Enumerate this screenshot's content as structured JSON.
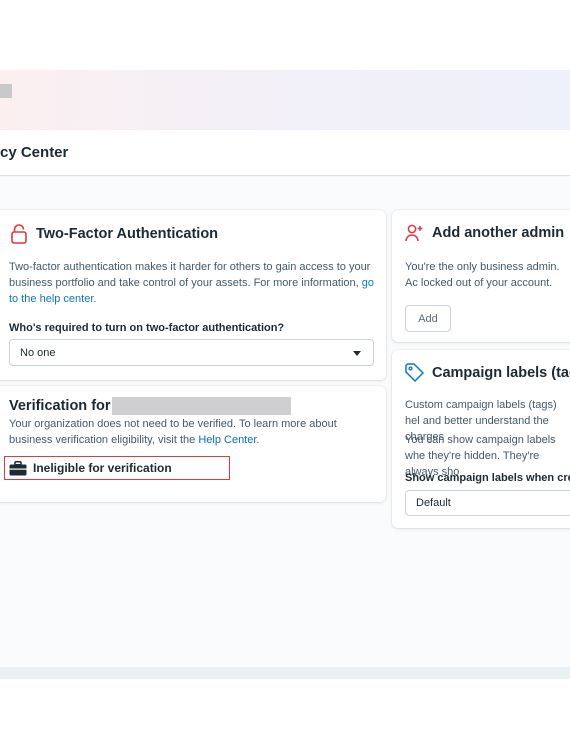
{
  "page": {
    "title": "cy Center"
  },
  "colors": {
    "accent_link": "#0a78be",
    "danger_outline": "#e0393e",
    "lock_icon": "#e0393e",
    "admin_icon": "#e0393e",
    "tag_icon": "#0a78be"
  },
  "two_factor": {
    "title": "Two-Factor Authentication",
    "icon": "lock-icon",
    "description": "Two-factor authentication makes it harder for others to gain access to your business portfolio and take control of your assets. For more information, ",
    "link_text": "go to the help center",
    "link_suffix": ".",
    "required_label": "Who's required to turn on two-factor authentication?",
    "required_value": "No one"
  },
  "verification": {
    "title": "Verification for",
    "description": "Your organization does not need to be verified. To learn more about business verification eligibility, visit the ",
    "link_text": "Help Center",
    "link_suffix": ".",
    "status_icon": "briefcase-icon",
    "status_label": "Ineligible for verification"
  },
  "add_admin": {
    "title": "Add another admin",
    "icon": "person-add-icon",
    "description": "You're the only business admin. Ac locked out of your account.",
    "button_label": "Add"
  },
  "campaign_labels": {
    "title": "Campaign labels (tags",
    "icon": "tag-icon",
    "description_1": "Custom campaign labels (tags) hel and better understand the charges",
    "description_2": "You can show campaign labels whe they're hidden. They're always sho",
    "setting_label": "Show campaign labels when crea",
    "setting_value": "Default"
  }
}
